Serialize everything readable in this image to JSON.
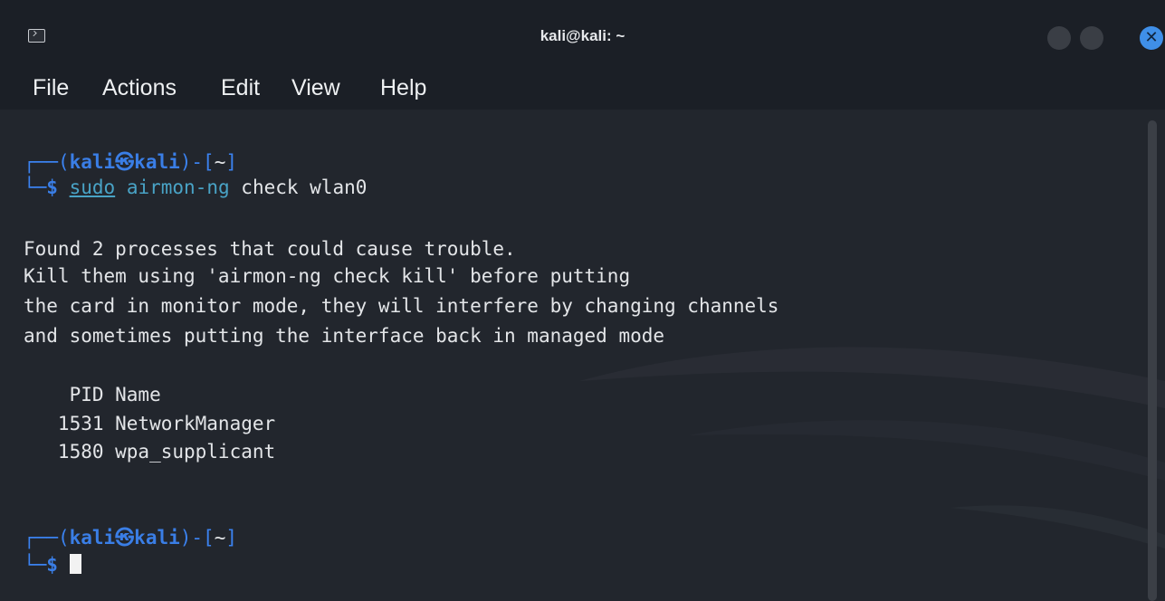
{
  "window": {
    "title": "kali@kali: ~",
    "close_glyph": "✕"
  },
  "menu": {
    "items": [
      "File",
      "Actions",
      "Edit",
      "View",
      "Help"
    ]
  },
  "terminal": {
    "prompt1": {
      "corner_top": "┌──",
      "paren_open": "(",
      "user": "kali",
      "at_symbol": "㉿",
      "host": "kali",
      "paren_close": ")-[",
      "dir": "~",
      "bracket_close": "]",
      "corner_bottom": "└─",
      "dollar": "$",
      "cmd_sudo": "sudo",
      "cmd_airmon": "airmon-ng",
      "cmd_args": "check wlan0"
    },
    "output": [
      "Found 2 processes that could cause trouble.",
      "Kill them using 'airmon-ng check kill' before putting",
      "the card in monitor mode, they will interfere by changing channels",
      "and sometimes putting the interface back in managed mode"
    ],
    "process_table": {
      "header": "    PID Name",
      "rows": [
        "   1531 NetworkManager",
        "   1580 wpa_supplicant"
      ]
    },
    "prompt2": {
      "corner_top": "┌──",
      "paren_open": "(",
      "user": "kali",
      "at_symbol": "㉿",
      "host": "kali",
      "paren_close": ")-[",
      "dir": "~",
      "bracket_close": "]",
      "corner_bottom": "└─",
      "dollar": "$"
    }
  },
  "colors": {
    "accent_blue": "#3a7ee6",
    "command_cyan": "#49a3c6",
    "text": "#e3e5e8",
    "background": "#22262d",
    "close_button": "#3f8fe8"
  },
  "icons": [
    "terminal-icon",
    "minimize-icon",
    "maximize-icon",
    "close-icon"
  ]
}
